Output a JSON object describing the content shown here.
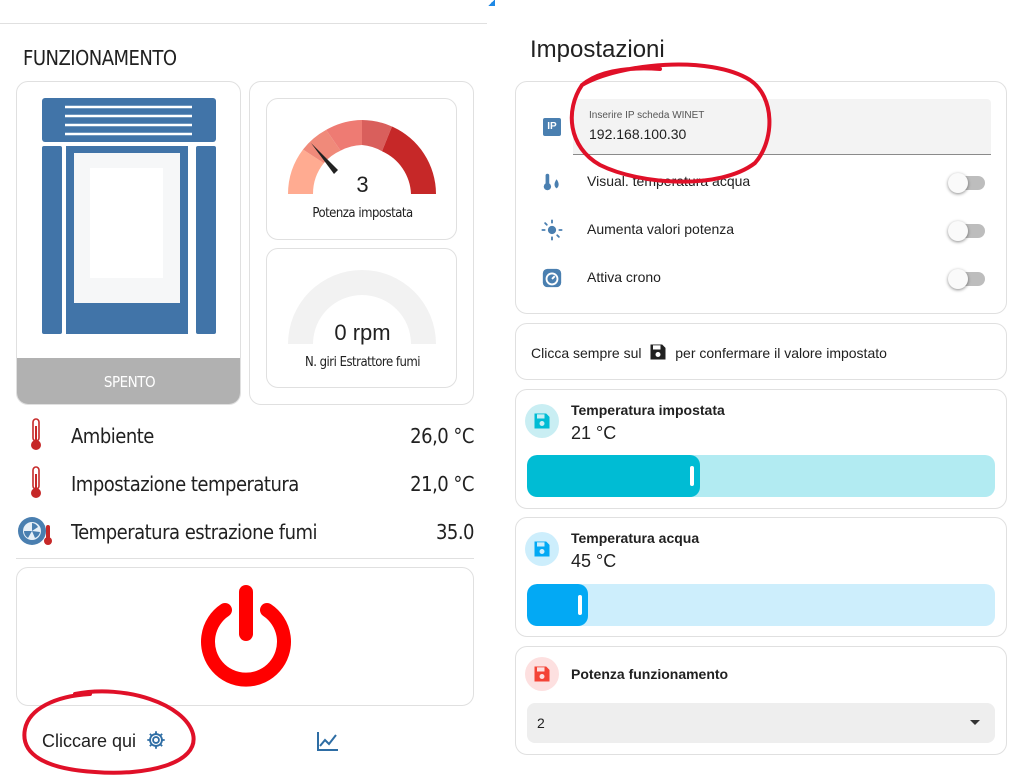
{
  "left_panel": {
    "title": "FUNZIONAMENTO",
    "stove_status": "SPENTO",
    "power_gauge": {
      "value": "3",
      "label": "Potenza impostata",
      "level": 3,
      "max": 5
    },
    "rpm_gauge": {
      "value": "0 rpm",
      "label": "N. giri Estrattore fumi",
      "level": 0
    },
    "sensors": [
      {
        "name": "Ambiente",
        "value": "26,0 °C",
        "icon": "thermometer-icon"
      },
      {
        "name": "Impostazione temperatura",
        "value": "21,0 °C",
        "icon": "thermometer-icon"
      },
      {
        "name": "Temperatura estrazione fumi",
        "value": "35.0",
        "icon": "fan-thermometer-icon"
      }
    ],
    "power_button_icon": "power-icon",
    "footer": {
      "settings_label": "Cliccare qui",
      "settings_icon": "gear-icon",
      "chart_icon": "chart-line-icon"
    }
  },
  "right_panel": {
    "title": "Impostazioni",
    "ip_field": {
      "label": "Inserire IP scheda WINET",
      "value": "192.168.100.30",
      "icon": "ip-icon"
    },
    "toggles": [
      {
        "label": "Visual. temperatura acqua",
        "icon": "water-thermometer-icon",
        "on": false
      },
      {
        "label": "Aumenta valori potenza",
        "icon": "sun-gear-icon",
        "on": false
      },
      {
        "label": "Attiva crono",
        "icon": "timer-icon",
        "on": false
      }
    ],
    "info": {
      "before": "Clicca sempre sul",
      "after": "per confermare il valore impostato",
      "icon": "floppy-icon"
    },
    "temp_setting": {
      "label": "Temperatura impostata",
      "value": "21 °C",
      "level": 0.37,
      "color": "#00bcd4",
      "track": "#b2ebf2"
    },
    "water_setting": {
      "label": "Temperatura acqua",
      "value": "45 °C",
      "level": 0.13,
      "color": "#03a9f4",
      "track": "#cdeefc"
    },
    "power_setting": {
      "label": "Potenza funzionamento",
      "value": "2"
    }
  },
  "colors": {
    "stove": "#4174a8",
    "power_red": "#ff0000",
    "gauge_dark": "#c62828",
    "gauge_light": "#ffab91"
  }
}
